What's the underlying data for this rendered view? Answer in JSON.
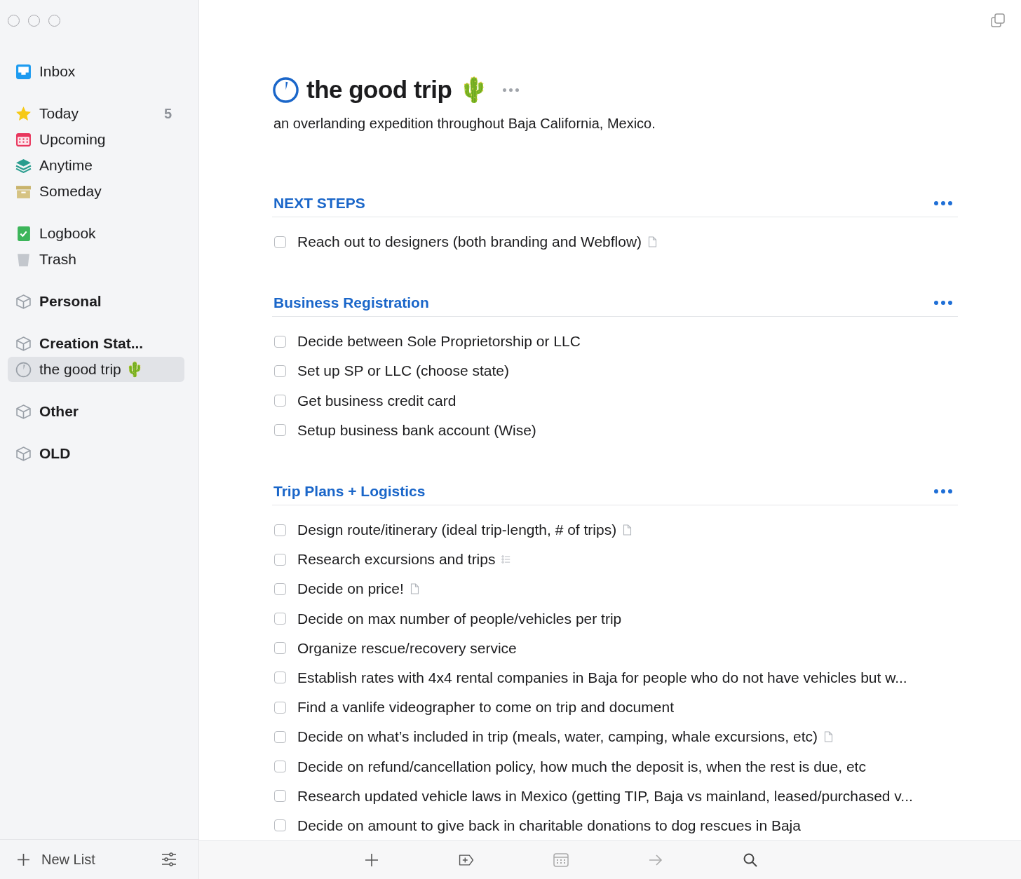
{
  "sidebar": {
    "groups": [
      [
        {
          "kind": "inbox",
          "label": "Inbox",
          "selected": false
        }
      ],
      [
        {
          "kind": "today",
          "label": "Today",
          "count": "5",
          "selected": false
        },
        {
          "kind": "upcoming",
          "label": "Upcoming",
          "selected": false
        },
        {
          "kind": "anytime",
          "label": "Anytime",
          "selected": false
        },
        {
          "kind": "someday",
          "label": "Someday",
          "selected": false
        }
      ],
      [
        {
          "kind": "logbook",
          "label": "Logbook",
          "selected": false
        },
        {
          "kind": "trash",
          "label": "Trash",
          "selected": false
        }
      ],
      [
        {
          "kind": "area",
          "label": "Personal",
          "selected": false
        }
      ],
      [
        {
          "kind": "area",
          "label": "Creation Stat...",
          "selected": false
        },
        {
          "kind": "project",
          "label": "the good trip 🌵",
          "selected": true
        }
      ],
      [
        {
          "kind": "area",
          "label": "Other",
          "selected": false
        }
      ],
      [
        {
          "kind": "area",
          "label": "OLD",
          "selected": false
        }
      ]
    ],
    "new_list": "New List"
  },
  "project": {
    "title": "the good trip 🌵",
    "notes": "an overlanding expedition throughout Baja California, Mexico."
  },
  "sections": [
    {
      "heading": "NEXT STEPS",
      "tasks": [
        {
          "text": "Reach out to designers (both branding and Webflow)",
          "checked": false,
          "kind": "note"
        }
      ]
    },
    {
      "heading": "Business Registration",
      "tasks": [
        {
          "text": "Decide between Sole Proprietorship or LLC",
          "checked": false,
          "kind": "plain"
        },
        {
          "text": "Set up SP or LLC (choose state)",
          "checked": false,
          "kind": "plain"
        },
        {
          "text": "Get business credit card",
          "checked": false,
          "kind": "plain"
        },
        {
          "text": "Setup business bank account (Wise)",
          "checked": false,
          "kind": "plain"
        }
      ]
    },
    {
      "heading": "Trip Plans + Logistics",
      "tasks": [
        {
          "text": "Design route/itinerary (ideal trip-length, # of trips)",
          "checked": false,
          "kind": "note"
        },
        {
          "text": "Research excursions and trips",
          "checked": false,
          "kind": "checklist"
        },
        {
          "text": "Decide on price!",
          "checked": false,
          "kind": "note"
        },
        {
          "text": "Decide on max number of people/vehicles per trip",
          "checked": false,
          "kind": "plain"
        },
        {
          "text": "Organize rescue/recovery service",
          "checked": false,
          "kind": "plain"
        },
        {
          "text": "Establish rates with 4x4 rental companies in Baja for people who do not have vehicles but w...",
          "checked": false,
          "kind": "plain"
        },
        {
          "text": "Find a vanlife videographer to come on trip and document",
          "checked": false,
          "kind": "plain"
        },
        {
          "text": "Decide on what’s included in trip (meals, water, camping, whale excursions, etc)",
          "checked": false,
          "kind": "note"
        },
        {
          "text": "Decide on refund/cancellation policy, how much the deposit is, when the rest is due, etc",
          "checked": false,
          "kind": "plain"
        },
        {
          "text": "Research updated vehicle laws in Mexico (getting TIP, Baja vs mainland, leased/purchased v...",
          "checked": false,
          "kind": "plain"
        },
        {
          "text": "Decide on amount to give back in charitable donations to dog rescues in Baja",
          "checked": false,
          "kind": "plain"
        }
      ]
    }
  ]
}
